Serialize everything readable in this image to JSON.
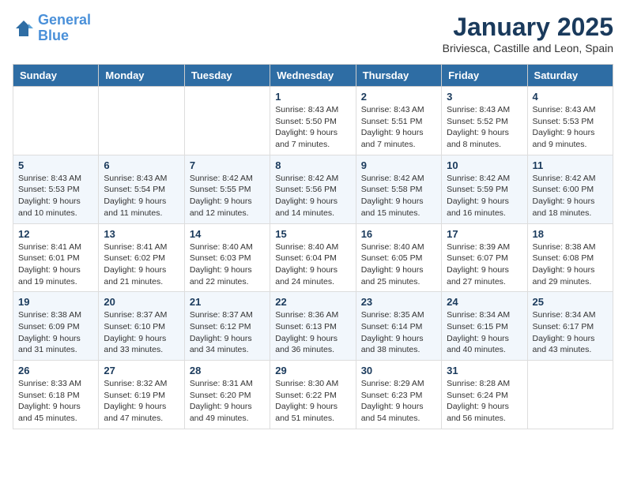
{
  "logo": {
    "line1": "General",
    "line2": "Blue"
  },
  "title": "January 2025",
  "subtitle": "Briviesca, Castille and Leon, Spain",
  "weekdays": [
    "Sunday",
    "Monday",
    "Tuesday",
    "Wednesday",
    "Thursday",
    "Friday",
    "Saturday"
  ],
  "weeks": [
    [
      {
        "day": "",
        "info": ""
      },
      {
        "day": "",
        "info": ""
      },
      {
        "day": "",
        "info": ""
      },
      {
        "day": "1",
        "info": "Sunrise: 8:43 AM\nSunset: 5:50 PM\nDaylight: 9 hours\nand 7 minutes."
      },
      {
        "day": "2",
        "info": "Sunrise: 8:43 AM\nSunset: 5:51 PM\nDaylight: 9 hours\nand 7 minutes."
      },
      {
        "day": "3",
        "info": "Sunrise: 8:43 AM\nSunset: 5:52 PM\nDaylight: 9 hours\nand 8 minutes."
      },
      {
        "day": "4",
        "info": "Sunrise: 8:43 AM\nSunset: 5:53 PM\nDaylight: 9 hours\nand 9 minutes."
      }
    ],
    [
      {
        "day": "5",
        "info": "Sunrise: 8:43 AM\nSunset: 5:53 PM\nDaylight: 9 hours\nand 10 minutes."
      },
      {
        "day": "6",
        "info": "Sunrise: 8:43 AM\nSunset: 5:54 PM\nDaylight: 9 hours\nand 11 minutes."
      },
      {
        "day": "7",
        "info": "Sunrise: 8:42 AM\nSunset: 5:55 PM\nDaylight: 9 hours\nand 12 minutes."
      },
      {
        "day": "8",
        "info": "Sunrise: 8:42 AM\nSunset: 5:56 PM\nDaylight: 9 hours\nand 14 minutes."
      },
      {
        "day": "9",
        "info": "Sunrise: 8:42 AM\nSunset: 5:58 PM\nDaylight: 9 hours\nand 15 minutes."
      },
      {
        "day": "10",
        "info": "Sunrise: 8:42 AM\nSunset: 5:59 PM\nDaylight: 9 hours\nand 16 minutes."
      },
      {
        "day": "11",
        "info": "Sunrise: 8:42 AM\nSunset: 6:00 PM\nDaylight: 9 hours\nand 18 minutes."
      }
    ],
    [
      {
        "day": "12",
        "info": "Sunrise: 8:41 AM\nSunset: 6:01 PM\nDaylight: 9 hours\nand 19 minutes."
      },
      {
        "day": "13",
        "info": "Sunrise: 8:41 AM\nSunset: 6:02 PM\nDaylight: 9 hours\nand 21 minutes."
      },
      {
        "day": "14",
        "info": "Sunrise: 8:40 AM\nSunset: 6:03 PM\nDaylight: 9 hours\nand 22 minutes."
      },
      {
        "day": "15",
        "info": "Sunrise: 8:40 AM\nSunset: 6:04 PM\nDaylight: 9 hours\nand 24 minutes."
      },
      {
        "day": "16",
        "info": "Sunrise: 8:40 AM\nSunset: 6:05 PM\nDaylight: 9 hours\nand 25 minutes."
      },
      {
        "day": "17",
        "info": "Sunrise: 8:39 AM\nSunset: 6:07 PM\nDaylight: 9 hours\nand 27 minutes."
      },
      {
        "day": "18",
        "info": "Sunrise: 8:38 AM\nSunset: 6:08 PM\nDaylight: 9 hours\nand 29 minutes."
      }
    ],
    [
      {
        "day": "19",
        "info": "Sunrise: 8:38 AM\nSunset: 6:09 PM\nDaylight: 9 hours\nand 31 minutes."
      },
      {
        "day": "20",
        "info": "Sunrise: 8:37 AM\nSunset: 6:10 PM\nDaylight: 9 hours\nand 33 minutes."
      },
      {
        "day": "21",
        "info": "Sunrise: 8:37 AM\nSunset: 6:12 PM\nDaylight: 9 hours\nand 34 minutes."
      },
      {
        "day": "22",
        "info": "Sunrise: 8:36 AM\nSunset: 6:13 PM\nDaylight: 9 hours\nand 36 minutes."
      },
      {
        "day": "23",
        "info": "Sunrise: 8:35 AM\nSunset: 6:14 PM\nDaylight: 9 hours\nand 38 minutes."
      },
      {
        "day": "24",
        "info": "Sunrise: 8:34 AM\nSunset: 6:15 PM\nDaylight: 9 hours\nand 40 minutes."
      },
      {
        "day": "25",
        "info": "Sunrise: 8:34 AM\nSunset: 6:17 PM\nDaylight: 9 hours\nand 43 minutes."
      }
    ],
    [
      {
        "day": "26",
        "info": "Sunrise: 8:33 AM\nSunset: 6:18 PM\nDaylight: 9 hours\nand 45 minutes."
      },
      {
        "day": "27",
        "info": "Sunrise: 8:32 AM\nSunset: 6:19 PM\nDaylight: 9 hours\nand 47 minutes."
      },
      {
        "day": "28",
        "info": "Sunrise: 8:31 AM\nSunset: 6:20 PM\nDaylight: 9 hours\nand 49 minutes."
      },
      {
        "day": "29",
        "info": "Sunrise: 8:30 AM\nSunset: 6:22 PM\nDaylight: 9 hours\nand 51 minutes."
      },
      {
        "day": "30",
        "info": "Sunrise: 8:29 AM\nSunset: 6:23 PM\nDaylight: 9 hours\nand 54 minutes."
      },
      {
        "day": "31",
        "info": "Sunrise: 8:28 AM\nSunset: 6:24 PM\nDaylight: 9 hours\nand 56 minutes."
      },
      {
        "day": "",
        "info": ""
      }
    ]
  ]
}
